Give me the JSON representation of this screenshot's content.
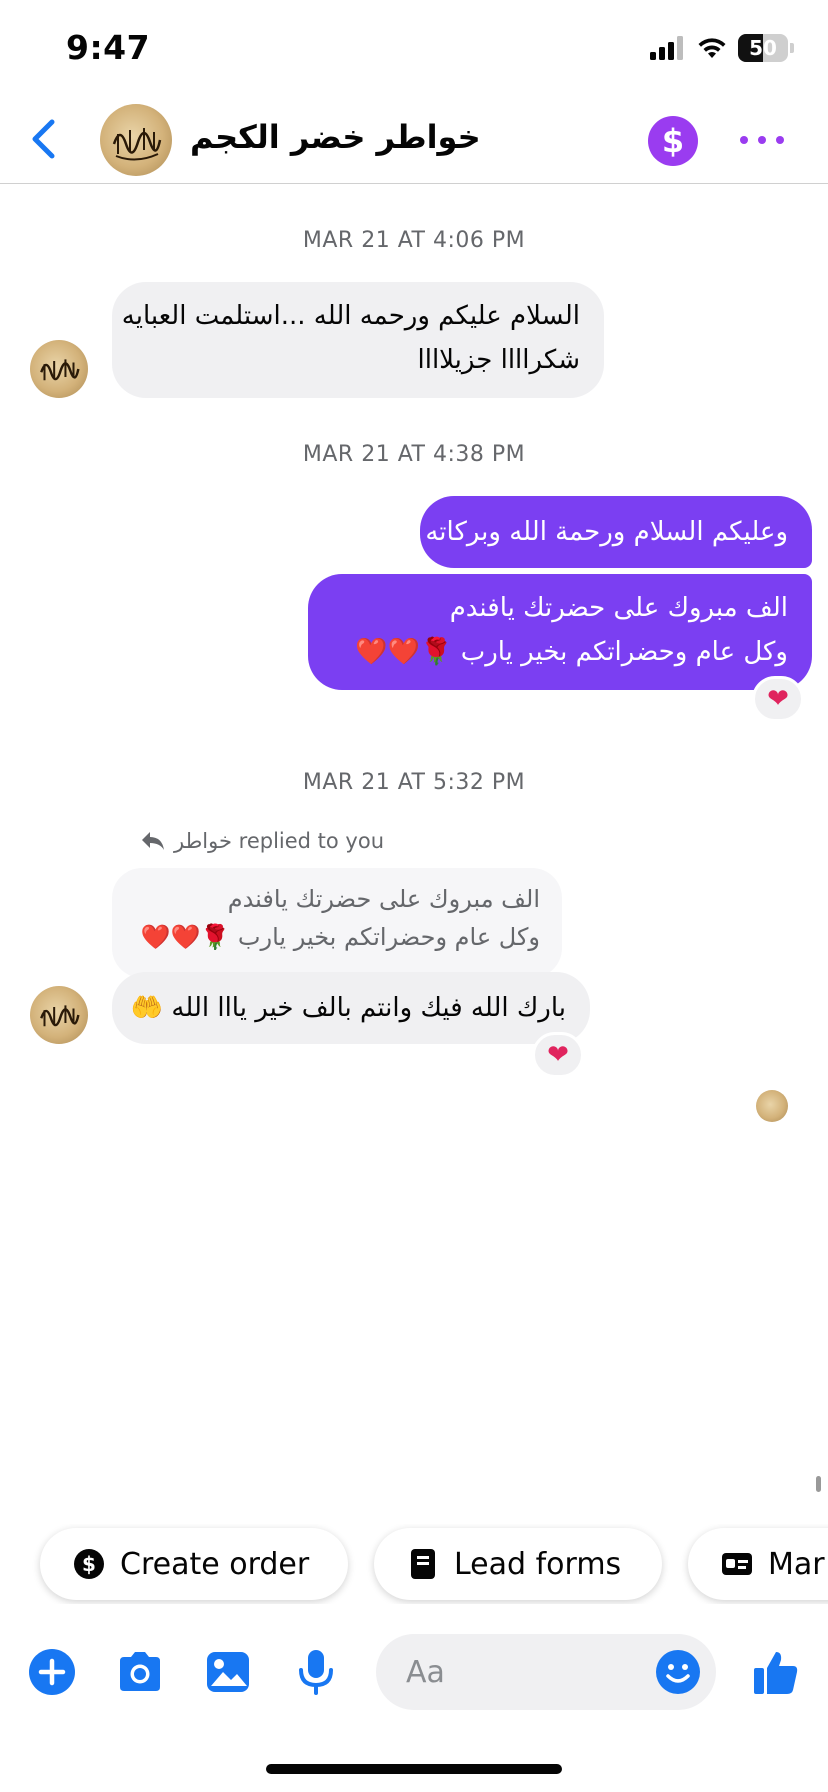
{
  "status_bar": {
    "time": "9:47",
    "battery": "50",
    "battery_level": 0.5
  },
  "header": {
    "title": "خواطر خضر الكجم",
    "icons": [
      "chevron-left-icon",
      "dollar-icon",
      "more-horizontal-icon"
    ],
    "accent_color": "#9a3cf0"
  },
  "conversation": {
    "timestamps": [
      "MAR 21 AT 4:06 PM",
      "MAR 21 AT 4:38 PM",
      "MAR 21 AT 5:32 PM"
    ],
    "msg1": {
      "line1": "السلام عليكم ورحمه الله ...استلمت العبايه",
      "line2": "شكراااا جزيلاااا"
    },
    "msg2": "وعليكم السلام ورحمة الله وبركاته",
    "msg3": {
      "line1": "الف مبروك على حضرتك يافندم",
      "line2": "وكل عام وحضراتكم بخير يارب 🌹❤️❤️"
    },
    "msg3_reaction": "❤",
    "reply_label": "خواطر replied to you",
    "quoted": {
      "line1": "الف مبروك على حضرتك يافندم",
      "line2": "وكل عام وحضراتكم بخير يارب 🌹❤️❤️"
    },
    "msg4": "بارك الله فيك وانتم بالف خير يااا الله 🤲",
    "msg4_reaction": "❤",
    "outgoing_color": "#7b3ff2",
    "incoming_color": "#f0f0f2"
  },
  "quick_actions": {
    "create_order": "Create order",
    "lead_forms": "Lead forms",
    "third": "Mar"
  },
  "composer": {
    "placeholder": "Aa",
    "icons": [
      "plus-icon",
      "camera-icon",
      "image-icon",
      "microphone-icon",
      "emoji-icon",
      "thumbs-up-icon"
    ],
    "icon_color": "#1877f2"
  }
}
